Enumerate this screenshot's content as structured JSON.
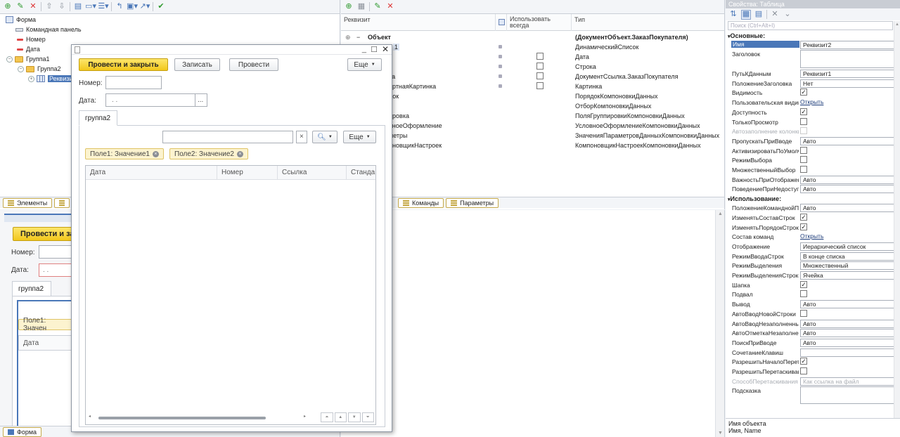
{
  "left_tree": {
    "items": [
      "Форма",
      "Командная панель",
      "Номер",
      "Дата",
      "Группа1",
      "Группа2",
      "Реквизит"
    ]
  },
  "left_tabs": [
    "Элементы"
  ],
  "preview_behind": {
    "post_close": "Провести и за",
    "number_label": "Номер:",
    "date_label": "Дата:",
    "date_value": ". .",
    "group_tab": "группа2",
    "chip": "Поле1: Значен",
    "col_date": "Дата"
  },
  "bottom_left_tab": "Форма",
  "attributes": {
    "headers": [
      "Реквизит",
      "Использовать всегда",
      "Тип"
    ],
    "rows": [
      {
        "name": "Объект",
        "type": "(ДокументОбъект.ЗаказПокупателя)",
        "use": null
      },
      {
        "name": "1",
        "type": "ДинамическийСписок",
        "use": null
      },
      {
        "name": "",
        "type": "Дата",
        "use": false
      },
      {
        "name": "р",
        "type": "Строка",
        "use": false
      },
      {
        "name": "ка",
        "type": "ДокументСсылка.ЗаказПокупателя",
        "use": false
      },
      {
        "name": "артнаяКартинка",
        "type": "Картинка",
        "use": false
      },
      {
        "name": "док",
        "type": "ПорядокКомпоновкиДанных",
        "use": null
      },
      {
        "name": "р",
        "type": "ОтборКомпоновкиДанных",
        "use": null
      },
      {
        "name": "ировка",
        "type": "ПоляГруппировкиКомпоновкиДанных",
        "use": null
      },
      {
        "name": "вноеОформление",
        "type": "УсловноеОформлениеКомпоновкиДанных",
        "use": null
      },
      {
        "name": "метры",
        "type": "ЗначенияПараметровДанныхКомпоновкиДанных",
        "use": null
      },
      {
        "name": "оновщикНастроек",
        "type": "КомпоновщикНастроекКомпоновкиДанных",
        "use": null
      }
    ],
    "tabs": [
      "Команды",
      "Параметры"
    ]
  },
  "dialog": {
    "post_close": "Провести и закрыть",
    "save": "Записать",
    "post": "Провести",
    "more": "Еще",
    "number_label": "Номер:",
    "date_label": "Дата:",
    "date_value": ". .",
    "date_btn": "...",
    "group_tab": "группа2",
    "search_more": "Еще",
    "chips": [
      "Поле1: Значение1",
      "Поле2: Значение2"
    ],
    "columns": [
      "Дата",
      "Номер",
      "Ссылка",
      "Станда"
    ]
  },
  "properties": {
    "title": "Свойства: Таблица",
    "search_placeholder": "Поиск (Ctrl+Alt+I)",
    "section_main": "Основные:",
    "section_use": "Использование:",
    "rows_main": [
      {
        "label": "Имя",
        "value": "Реквизит2",
        "kind": "input"
      },
      {
        "label": "Заголовок",
        "value": "",
        "kind": "tall"
      },
      {
        "label": "ПутьКДанным",
        "value": "Реквизит1",
        "kind": "input"
      },
      {
        "label": "ПоложениеЗаголовка",
        "value": "Нет",
        "kind": "select"
      },
      {
        "label": "Видимость",
        "value": true,
        "kind": "check"
      },
      {
        "label": "Пользовательская видимость",
        "value": "Открыть",
        "kind": "link"
      },
      {
        "label": "Доступность",
        "value": true,
        "kind": "check"
      },
      {
        "label": "ТолькоПросмотр",
        "value": false,
        "kind": "check"
      },
      {
        "label": "Автозаполнение колонки",
        "value": false,
        "kind": "check",
        "disabled": true
      },
      {
        "label": "ПропускатьПриВводе",
        "value": "Авто",
        "kind": "select"
      },
      {
        "label": "АктивизироватьПоУмолчанию",
        "value": false,
        "kind": "check"
      },
      {
        "label": "РежимВыбора",
        "value": false,
        "kind": "check"
      },
      {
        "label": "МножественныйВыбор",
        "value": false,
        "kind": "check"
      },
      {
        "label": "ВажностьПриОтображении",
        "value": "Авто",
        "kind": "select"
      },
      {
        "label": "ПоведениеПриНедоступности",
        "value": "Авто",
        "kind": "select"
      }
    ],
    "rows_use": [
      {
        "label": "ПоложениеКоманднойПанели",
        "value": "Авто",
        "kind": "select"
      },
      {
        "label": "ИзменятьСоставСтрок",
        "value": true,
        "kind": "check"
      },
      {
        "label": "ИзменятьПорядокСтрок",
        "value": true,
        "kind": "check"
      },
      {
        "label": "Состав команд",
        "value": "Открыть",
        "kind": "link"
      },
      {
        "label": "Отображение",
        "value": "Иерархический список",
        "kind": "select"
      },
      {
        "label": "РежимВводаСтрок",
        "value": "В конце списка",
        "kind": "select"
      },
      {
        "label": "РежимВыделения",
        "value": "Множественный",
        "kind": "select"
      },
      {
        "label": "РежимВыделенияСтроки",
        "value": "Ячейка",
        "kind": "select"
      },
      {
        "label": "Шапка",
        "value": true,
        "kind": "check"
      },
      {
        "label": "Подвал",
        "value": false,
        "kind": "check"
      },
      {
        "label": "Вывод",
        "value": "Авто",
        "kind": "select"
      },
      {
        "label": "АвтоВводНовойСтроки",
        "value": false,
        "kind": "check"
      },
      {
        "label": "АвтоВводНезаполненных",
        "value": "Авто",
        "kind": "select"
      },
      {
        "label": "АвтоОтметкаНезаполненного",
        "value": "Авто",
        "kind": "select"
      },
      {
        "label": "ПоискПриВводе",
        "value": "Авто",
        "kind": "select"
      },
      {
        "label": "СочетаниеКлавиш",
        "value": "",
        "kind": "clear"
      },
      {
        "label": "РазрешитьНачалоПеретаскивания",
        "value": true,
        "kind": "check"
      },
      {
        "label": "РазрешитьПеретаскивание",
        "value": false,
        "kind": "check"
      },
      {
        "label": "СпособПеретаскивания",
        "value": "Как ссылка на файл",
        "kind": "select",
        "disabled": true
      },
      {
        "label": "Подсказка",
        "value": "",
        "kind": "tall"
      }
    ],
    "footer_title": "Имя объекта",
    "footer_text": "Имя, Name"
  }
}
